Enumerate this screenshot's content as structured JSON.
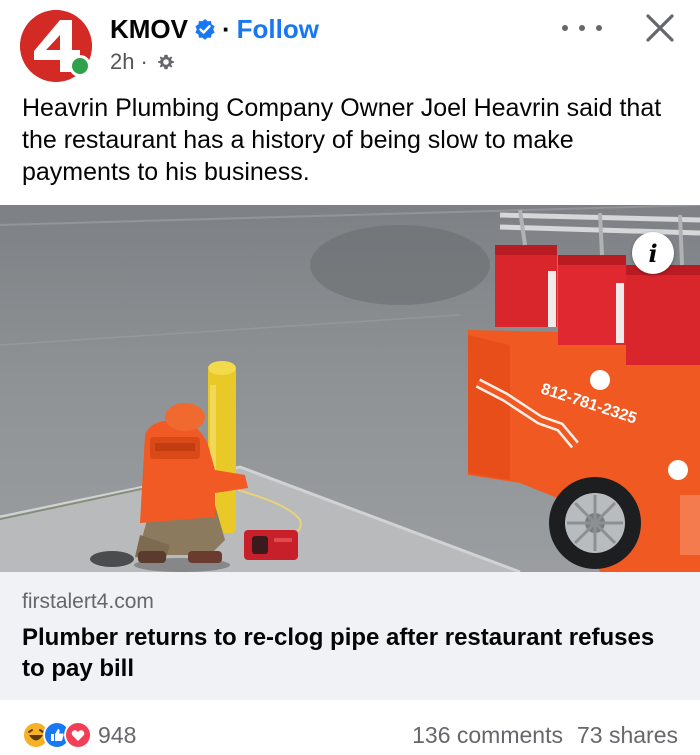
{
  "header": {
    "page_name": "KMOV",
    "separator": "·",
    "follow_label": "Follow",
    "time": "2h",
    "time_separator": "·",
    "avatar_logo": "4",
    "verified_icon": "verified-badge-icon",
    "privacy_icon": "gear-icon"
  },
  "post": {
    "text": "Heavrin Plumbing Company Owner Joel Heavrin said that the restaurant has a history of being slow to make payments to his business."
  },
  "photo": {
    "truck_phone": "812-781-2325",
    "info_label": "i"
  },
  "link_card": {
    "domain": "firstalert4.com",
    "title": "Plumber returns to re-clog pipe after restaurant refuses to pay bill"
  },
  "footer": {
    "reaction_count": "948",
    "comments": "136 comments",
    "shares": "73 shares"
  },
  "colors": {
    "brand_red": "#d42a26",
    "link_blue": "#1877f2",
    "online_green": "#31a24c",
    "card_bg": "#f0f2f5",
    "truck_orange": "#f05a22"
  }
}
